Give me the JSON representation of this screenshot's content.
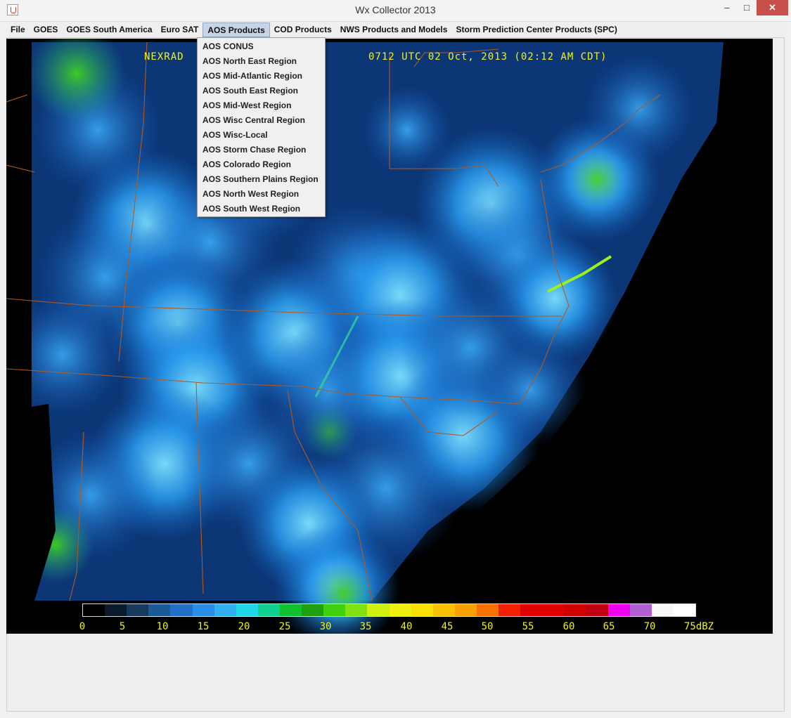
{
  "window": {
    "title": "Wx Collector 2013",
    "minimize": "–",
    "maximize": "□",
    "close": "✕"
  },
  "menubar": [
    {
      "label": "File"
    },
    {
      "label": "GOES"
    },
    {
      "label": "GOES South America"
    },
    {
      "label": "Euro SAT"
    },
    {
      "label": "AOS Products",
      "active": true
    },
    {
      "label": "COD Products"
    },
    {
      "label": "NWS Products and Models"
    },
    {
      "label": "Storm Prediction Center Products (SPC)"
    }
  ],
  "dropdown": {
    "items": [
      "AOS CONUS",
      "AOS North East Region",
      "AOS Mid-Atlantic Region",
      "AOS South East Region",
      "AOS Mid-West Region",
      "AOS Wisc Central Region",
      "AOS Wisc-Local",
      "AOS Storm Chase Region",
      "AOS Colorado Region",
      "AOS Southern Plains Region",
      "AOS North West Region",
      "AOS South West Region"
    ]
  },
  "radar": {
    "header_left": "NEXRAD",
    "header_right": "0712 UTC 02 Oct, 2013 (02:12 AM CDT)",
    "legend_ticks": [
      "0",
      "5",
      "10",
      "15",
      "20",
      "25",
      "30",
      "35",
      "40",
      "45",
      "50",
      "55",
      "60",
      "65",
      "70",
      "75dBZ"
    ],
    "legend_colors": [
      "#000000",
      "#0a1a2a",
      "#153a5a",
      "#1c5a96",
      "#2070c8",
      "#2a8ee8",
      "#30b0f0",
      "#22d8e8",
      "#10d090",
      "#10c030",
      "#20a010",
      "#40d010",
      "#80e010",
      "#d0f010",
      "#f0f010",
      "#f8e000",
      "#f8c000",
      "#f8a000",
      "#f87000",
      "#f02000",
      "#e00000",
      "#e00000",
      "#d00000",
      "#c00010",
      "#f000f0",
      "#b060d0",
      "#f8f8f8",
      "#ffffff"
    ],
    "colors": {
      "map_lines": "#b05a20",
      "text": "#f2f218",
      "background": "#000000"
    }
  }
}
